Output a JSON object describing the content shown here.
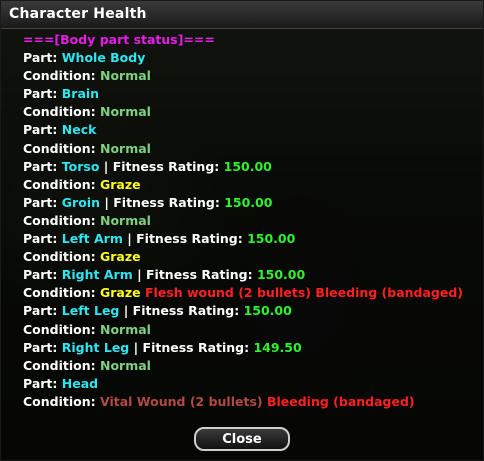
{
  "window": {
    "title": "Character Health"
  },
  "header": "===[Body part status]===",
  "labels": {
    "part": "Part: ",
    "condition": "Condition: ",
    "separator": " | ",
    "fitness": "Fitness Rating: ",
    "space": " "
  },
  "parts": [
    {
      "name": "Whole Body",
      "condition": "Normal"
    },
    {
      "name": "Brain",
      "condition": "Normal"
    },
    {
      "name": "Neck",
      "condition": "Normal"
    },
    {
      "name": "Torso",
      "fitness": "150.00",
      "condition": "Graze"
    },
    {
      "name": "Groin",
      "fitness": "150.00",
      "condition": "Normal"
    },
    {
      "name": "Left Arm",
      "fitness": "150.00",
      "condition": "Graze"
    },
    {
      "name": "Right Arm",
      "fitness": "150.00",
      "condition": "Graze",
      "extra1": "Flesh wound (2 bullets)",
      "extra2": "Bleeding (bandaged)"
    },
    {
      "name": "Left Leg",
      "fitness": "150.00",
      "condition": "Normal"
    },
    {
      "name": "Right Leg",
      "fitness": "149.50",
      "condition": "Normal"
    },
    {
      "name": "Head",
      "condition": "Vital Wound (2 bullets)",
      "extra2": "Bleeding (bandaged)"
    }
  ],
  "buttons": {
    "close": "Close"
  },
  "colors": {
    "header": "#e81ce8",
    "part_name": "#2ee6f2",
    "normal": "#7fd07f",
    "graze": "#ffff1a",
    "fitness_value": "#2df22d",
    "wound": "#ff2020",
    "vital_wound": "#b24a43"
  }
}
